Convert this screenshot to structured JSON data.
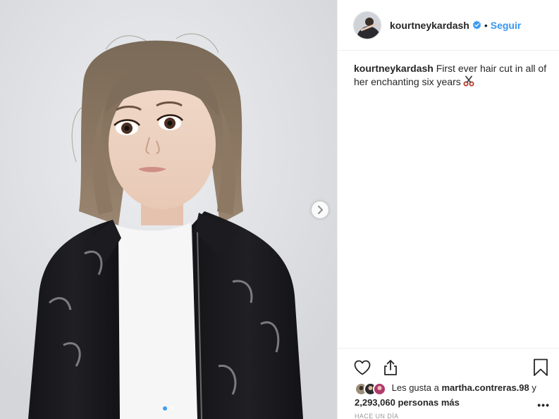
{
  "post": {
    "image_alt": "Portrait of a child with a bob haircut wearing a white t-shirt and a black vinyl jacket",
    "carousel": {
      "count": 2,
      "active_index": 0
    }
  },
  "header": {
    "username": "kourtneykardash",
    "separator": "•",
    "follow_label": "Seguir"
  },
  "caption": {
    "username": "kourtneykardash",
    "text": "First ever hair cut in all of her enchanting six years"
  },
  "likes": {
    "prefix": "Les gusta a",
    "liker": "martha.contreras.98",
    "conjunction": "y",
    "count": "2,293,060 personas más"
  },
  "timestamp": "Hace un día",
  "more_label": "•••",
  "icons": {
    "verified": "verified-badge-icon",
    "like": "heart-icon",
    "share": "share-icon",
    "save": "bookmark-icon",
    "next": "chevron-right-icon",
    "caption_emoji": "scissors-emoji-icon"
  },
  "colors": {
    "link": "#3897f0",
    "text": "#262626",
    "muted": "#999999"
  }
}
